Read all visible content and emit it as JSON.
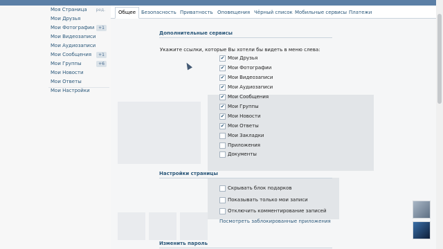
{
  "sidebar": {
    "items": [
      {
        "label": "Моя Страница",
        "edit": "ред.",
        "badge": ""
      },
      {
        "label": "Мои Друзья",
        "edit": "",
        "badge": ""
      },
      {
        "label": "Мои Фотографии",
        "edit": "",
        "badge": "+1"
      },
      {
        "label": "Мои Видеозаписи",
        "edit": "",
        "badge": ""
      },
      {
        "label": "Мои Аудиозаписи",
        "edit": "",
        "badge": ""
      },
      {
        "label": "Мои Сообщения",
        "edit": "",
        "badge": "+1"
      },
      {
        "label": "Мои Группы",
        "edit": "",
        "badge": "+6"
      },
      {
        "label": "Мои Новости",
        "edit": "",
        "badge": ""
      },
      {
        "label": "Мои Ответы",
        "edit": "",
        "badge": ""
      },
      {
        "label": "Мои Настройки",
        "edit": "",
        "badge": ""
      }
    ]
  },
  "tabs": [
    {
      "label": "Общее",
      "active": true
    },
    {
      "label": "Безопасность",
      "active": false
    },
    {
      "label": "Приватность",
      "active": false
    },
    {
      "label": "Оповещения",
      "active": false
    },
    {
      "label": "Чёрный список",
      "active": false
    },
    {
      "label": "Мобильные сервисы",
      "active": false
    },
    {
      "label": "Платежи",
      "active": false
    }
  ],
  "services": {
    "title": "Дополнительные сервисы",
    "prompt": "Укажите ссылки, которые Вы хотели бы видеть в меню слева:",
    "options": [
      {
        "label": "Мои Друзья",
        "checked": true
      },
      {
        "label": "Мои Фотографии",
        "checked": true
      },
      {
        "label": "Мои Видеозаписи",
        "checked": true
      },
      {
        "label": "Мои Аудиозаписи",
        "checked": true
      },
      {
        "label": "Мои Сообщения",
        "checked": true
      },
      {
        "label": "Мои Группы",
        "checked": true
      },
      {
        "label": "Мои Новости",
        "checked": true
      },
      {
        "label": "Мои Ответы",
        "checked": true
      },
      {
        "label": "Мои Закладки",
        "checked": false
      },
      {
        "label": "Приложения",
        "checked": false
      },
      {
        "label": "Документы",
        "checked": false
      }
    ]
  },
  "page_settings": {
    "title": "Настройки страницы",
    "options": [
      {
        "label": "Скрывать блок подарков",
        "checked": false
      },
      {
        "label": "Показывать только мои записи",
        "checked": false
      },
      {
        "label": "Отключить комментирование записей",
        "checked": false
      }
    ],
    "link": "Посмотреть заблокированные приложения"
  },
  "password": {
    "title": "Изменить пароль"
  },
  "colors": {
    "accent": "#2b587a",
    "header": "#5b7fa6"
  }
}
